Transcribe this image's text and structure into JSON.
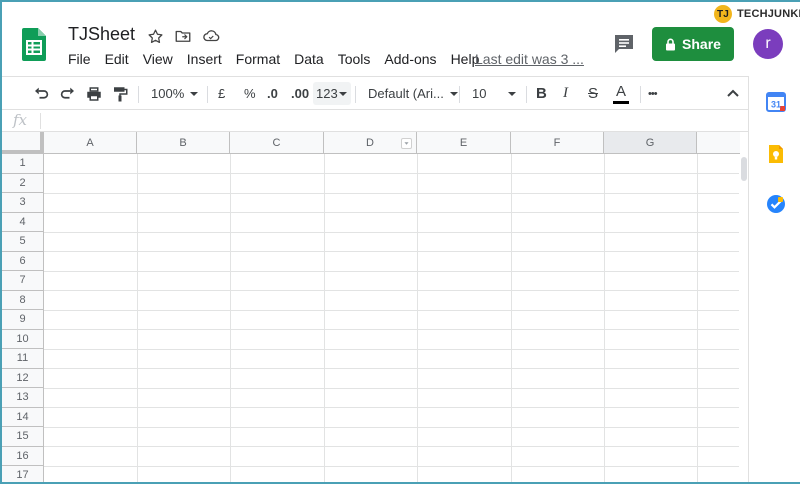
{
  "app": {
    "doc_title": "TJSheet",
    "last_edit": "Last edit was 3 ...",
    "share_label": "Share",
    "avatar_letter": "r",
    "brand": "TECHJUNKIE",
    "brand_mark": "TJ"
  },
  "menu": [
    "File",
    "Edit",
    "View",
    "Insert",
    "Format",
    "Data",
    "Tools",
    "Add-ons",
    "Help"
  ],
  "toolbar": {
    "zoom": "100%",
    "currency": "£",
    "percent": "%",
    "dec_decrease": ".0",
    "dec_increase": ".00",
    "more_formats": "123",
    "font": "Default (Ari...",
    "font_size": "10",
    "bold": "B",
    "italic": "I",
    "strike": "S",
    "text_color_letter": "A",
    "more": "•••"
  },
  "formula_bar": {
    "fx": "fx",
    "value": ""
  },
  "grid": {
    "columns": [
      "A",
      "B",
      "C",
      "D",
      "E",
      "F",
      "G"
    ],
    "rows": [
      "1",
      "2",
      "3",
      "4",
      "5",
      "6",
      "7",
      "8",
      "9",
      "10",
      "11",
      "12",
      "13",
      "14",
      "15",
      "16",
      "17"
    ],
    "selected_column": "G"
  },
  "colors": {
    "share_green": "#1e8e3e",
    "avatar_purple": "#7b3dbd",
    "sheets_green": "#0f9d58",
    "brand_yellow": "#f2b51c",
    "frame_teal": "#4aa0b5"
  }
}
